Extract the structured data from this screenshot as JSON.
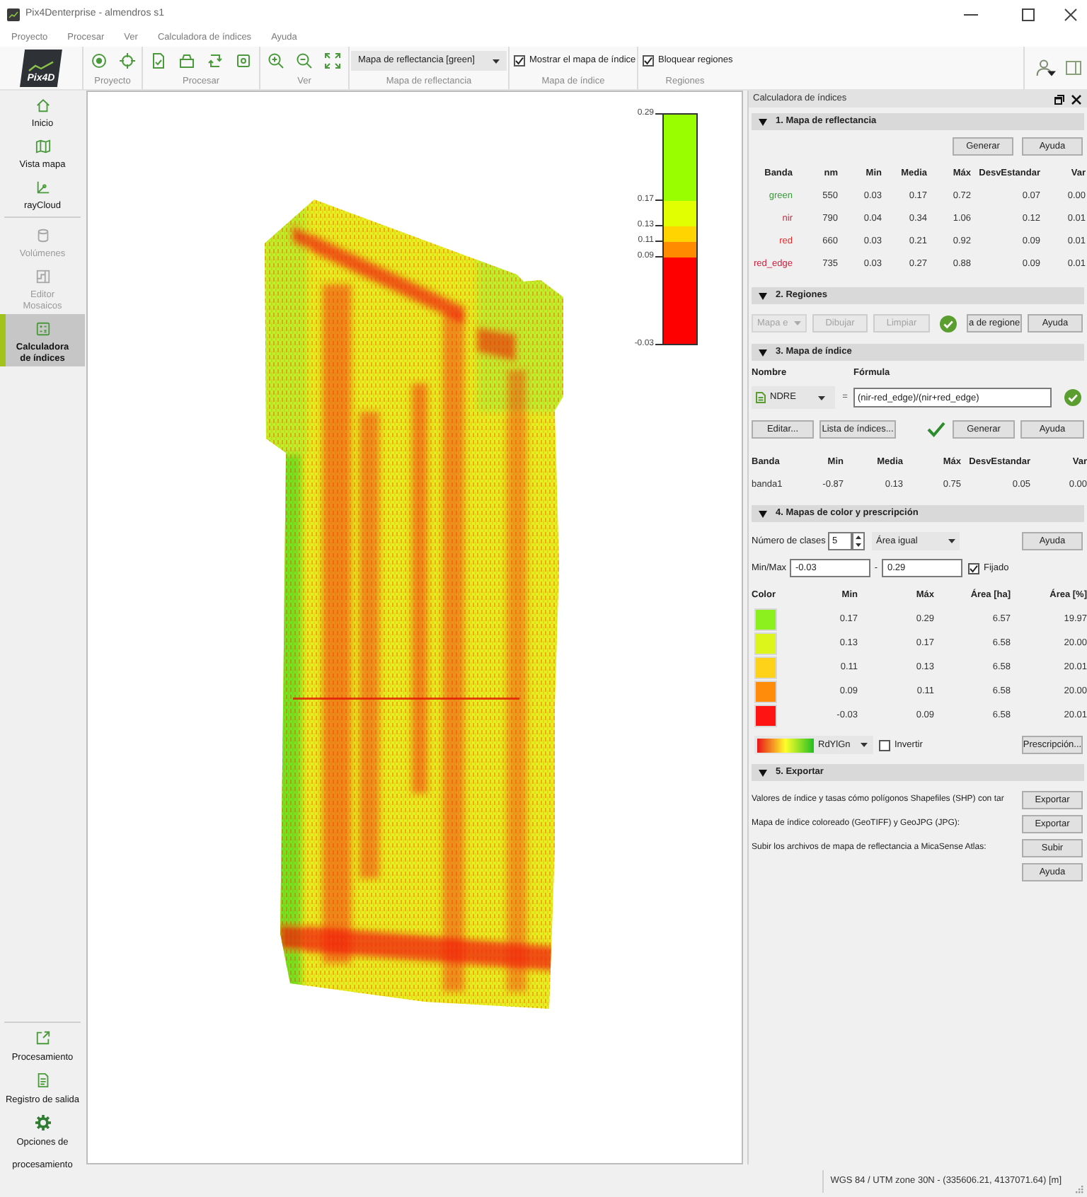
{
  "window": {
    "title": "Pix4Denterprise - almendros s1"
  },
  "menu": [
    "Proyecto",
    "Procesar",
    "Ver",
    "Calculadora de índices",
    "Ayuda"
  ],
  "toolbar": {
    "logo": "Pix4D",
    "groups": [
      {
        "kind": "icons",
        "label": "Proyecto"
      },
      {
        "kind": "icons",
        "label": "Procesar"
      },
      {
        "kind": "icons",
        "label": "Ver"
      },
      {
        "kind": "dropdown",
        "label": "Mapa de reflectancia",
        "value": "Mapa de reflectancia [green]"
      },
      {
        "kind": "checkbox",
        "label": "Mapa de índice",
        "text": "Mostrar el mapa de índice",
        "checked": true
      },
      {
        "kind": "checkbox",
        "label": "Regiones",
        "text": "Bloquear regiones",
        "checked": true
      }
    ]
  },
  "sidebar": {
    "groups": [
      {
        "items": [
          {
            "label": "Inicio",
            "selected": false,
            "disabled": false
          },
          {
            "label": "Vista mapa",
            "selected": false,
            "disabled": false
          },
          {
            "label": "rayCloud",
            "selected": false,
            "disabled": false
          }
        ]
      },
      {
        "items": [
          {
            "label": "Volúmenes",
            "selected": false,
            "disabled": true
          },
          {
            "label": "Editor Mosaicos",
            "selected": false,
            "disabled": true
          },
          {
            "label": "Calculadora de índices",
            "selected": true,
            "disabled": false
          }
        ]
      }
    ],
    "bottom_items": [
      "Procesamiento",
      "Registro de salida",
      "Opciones de procesamiento"
    ]
  },
  "map": {
    "legend": {
      "ticks": [
        "0.29",
        "0.17",
        "0.13",
        "0.11",
        "0.09",
        "-0.03"
      ],
      "segments": [
        {
          "color": "#99ff00"
        },
        {
          "color": "#e2ff00"
        },
        {
          "color": "#ffd400"
        },
        {
          "color": "#ff8c00"
        },
        {
          "color": "#ff0000"
        }
      ]
    }
  },
  "panel": {
    "title": "Calculadora de índices",
    "reflectance": {
      "header": "1. Mapa de reflectancia",
      "expanded": true,
      "buttons": [
        "Generar",
        "Ayuda"
      ],
      "table": {
        "columns": [
          "Banda",
          "nm",
          "Min",
          "Media",
          "Máx",
          "DesvEstandar",
          "Var"
        ],
        "rows": [
          {
            "color": "#3a9a3a",
            "cells": [
              "green",
              "550",
              "0.03",
              "0.17",
              "0.72",
              "0.07",
              "0.00"
            ]
          },
          {
            "color": "#b8323f",
            "cells": [
              "nir",
              "790",
              "0.04",
              "0.34",
              "1.06",
              "0.12",
              "0.01"
            ]
          },
          {
            "color": "#e42a2a",
            "cells": [
              "red",
              "660",
              "0.03",
              "0.21",
              "0.92",
              "0.09",
              "0.01"
            ]
          },
          {
            "color": "#d0203c",
            "cells": [
              "red_edge",
              "735",
              "0.03",
              "0.27",
              "0.88",
              "0.09",
              "0.01"
            ]
          }
        ]
      }
    },
    "regions": {
      "header": "2. Regiones",
      "expanded": true,
      "controls": [
        {
          "kind": "dropdown",
          "label": "Mapa e",
          "disabled": true
        },
        {
          "kind": "button",
          "label": "Dibujar",
          "disabled": true
        },
        {
          "kind": "button",
          "label": "Limpiar",
          "disabled": true
        },
        {
          "kind": "badge"
        },
        {
          "kind": "button",
          "label": "a de regione",
          "disabled": false
        },
        {
          "kind": "button",
          "label": "Ayuda",
          "disabled": false
        }
      ]
    },
    "index_map": {
      "header": "3. Mapa de índice",
      "expanded": true,
      "name_label": "Nombre",
      "formula_label": "Fórmula",
      "index": "NDRE",
      "equals": "=",
      "formula": "(nir-red_edge)/(nir+red_edge)",
      "formula_valid": true,
      "controls": [
        {
          "kind": "button",
          "label": "Editar..."
        },
        {
          "kind": "button",
          "label": "Lista de índices..."
        },
        {
          "kind": "tick"
        },
        {
          "kind": "button",
          "label": "Generar"
        },
        {
          "kind": "button",
          "label": "Ayuda"
        }
      ],
      "table": {
        "columns": [
          "Banda",
          "Min",
          "Media",
          "Máx",
          "DesvEstandar",
          "Var"
        ],
        "rows": [
          [
            "banda1",
            "-0.87",
            "0.13",
            "0.75",
            "0.05",
            "0.00"
          ]
        ]
      }
    },
    "color_maps": {
      "header": "4. Mapas de color y prescripción",
      "expanded": true,
      "classes_label": "Número de clases",
      "classes": "5",
      "method": "Área igual",
      "help": "Ayuda",
      "minmax_label": "Min/Max",
      "min": "-0.03",
      "range_separator": "-",
      "max": "0.29",
      "fixed": {
        "label": "Fijado",
        "checked": true
      },
      "table": {
        "swatch_column": "Color",
        "columns": [
          "Min",
          "Máx",
          "Área [ha]",
          "Área [%]"
        ],
        "rows": [
          {
            "color": "#8cf01e",
            "cells": [
              "0.17",
              "0.29",
              "6.57",
              "19.97"
            ]
          },
          {
            "color": "#dcf51a",
            "cells": [
              "0.13",
              "0.17",
              "6.58",
              "20.00"
            ]
          },
          {
            "color": "#ffd21a",
            "cells": [
              "0.11",
              "0.13",
              "6.58",
              "20.01"
            ]
          },
          {
            "color": "#ff8c0a",
            "cells": [
              "0.09",
              "0.11",
              "6.58",
              "20.00"
            ]
          },
          {
            "color": "#ff1414",
            "cells": [
              "-0.03",
              "0.09",
              "6.58",
              "20.01"
            ]
          }
        ]
      },
      "colormap": "RdYlGn",
      "invert": {
        "label": "Invertir",
        "checked": false
      },
      "prescription": "Prescripción..."
    },
    "export": {
      "header": "5. Exportar",
      "expanded": true,
      "rows": [
        {
          "text": "Valores de índice y tasas cómo polígonos Shapefiles (SHP) con tar",
          "button": "Exportar"
        },
        {
          "text": "Mapa de índice coloreado (GeoTIFF) y GeoJPG (JPG):",
          "button": "Exportar"
        },
        {
          "text": "Subir los archivos de mapa de reflectancia a MicaSense Atlas:",
          "button": "Subir"
        }
      ],
      "help": "Ayuda"
    }
  },
  "status_bar": {
    "text": "WGS 84 / UTM zone 30N - (335606.21, 4137071.64) [m]"
  }
}
